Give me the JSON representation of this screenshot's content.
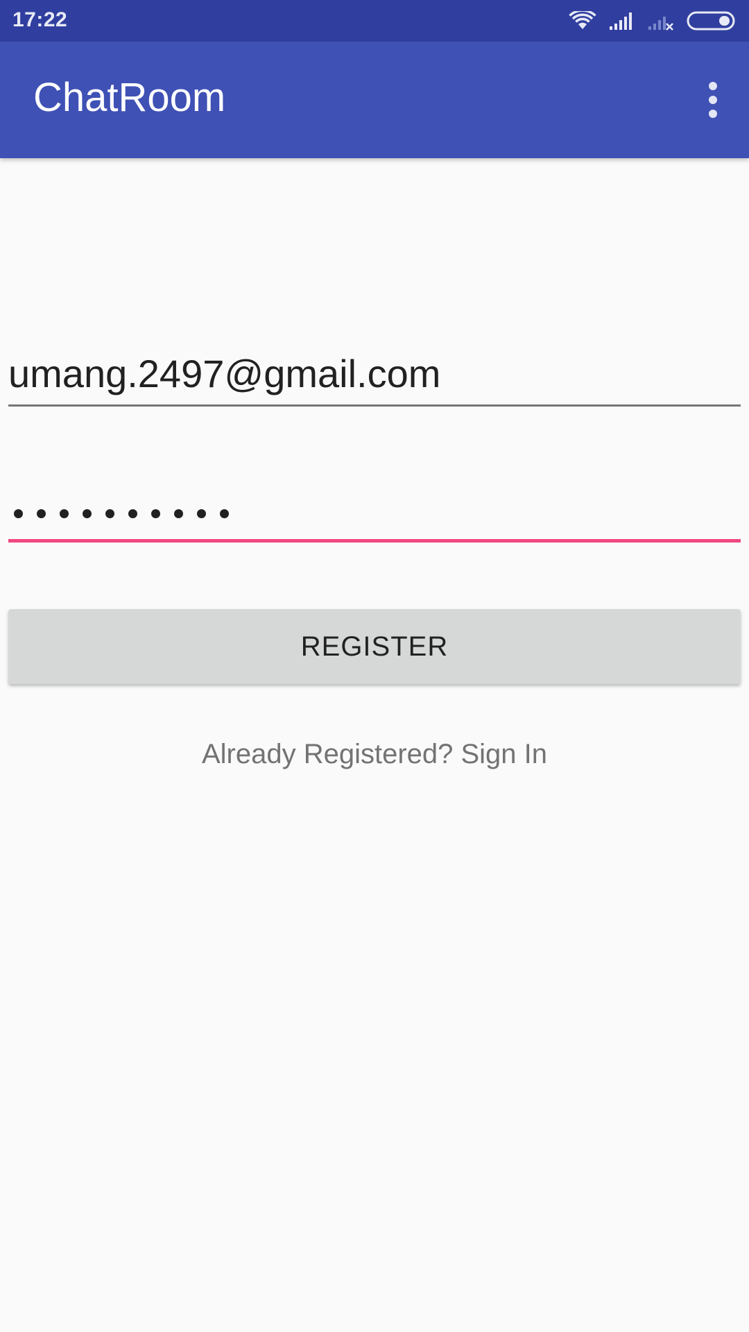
{
  "status_bar": {
    "time": "17:22",
    "icons": [
      "wifi-icon",
      "signal-icon",
      "signal-no-sim-icon",
      "battery-icon"
    ]
  },
  "app_bar": {
    "title": "ChatRoom",
    "menu_icon": "more-vert-icon"
  },
  "form": {
    "email_value": "umang.2497@gmail.com",
    "password_length": 10,
    "register_label": "REGISTER",
    "signin_link": "Already Registered? Sign In"
  },
  "colors": {
    "status_bar": "#303f9f",
    "app_bar": "#3f51b5",
    "accent": "#f0477f",
    "button": "#d6d7d7"
  }
}
